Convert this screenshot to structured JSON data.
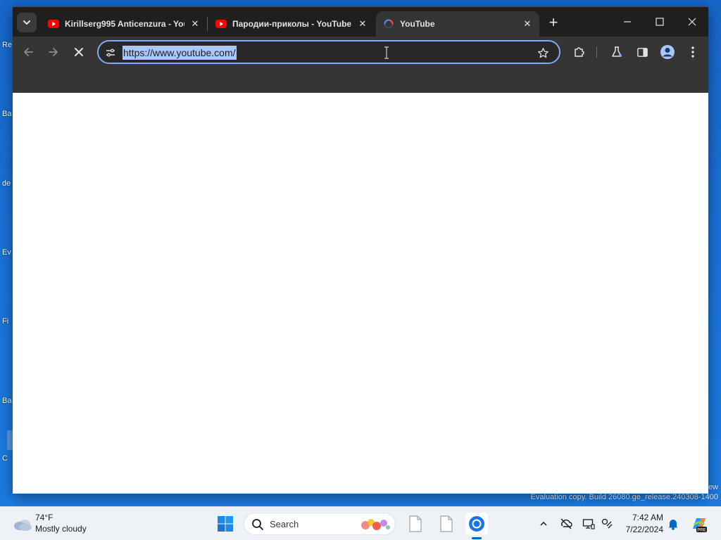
{
  "desktop": {
    "icon_labels": [
      "Re",
      "Ba",
      "de",
      "Ev",
      "Fi",
      "Ba",
      "C"
    ],
    "watermark_line1": "ew",
    "watermark_line2": "Evaluation copy. Build 26080.ge_release.240308-1400"
  },
  "browser": {
    "tabs": [
      {
        "title": "Kirillserg995 Anticenzura - You",
        "favicon": "youtube-icon",
        "active": false
      },
      {
        "title": "Пародии-приколы - YouTube",
        "favicon": "youtube-icon",
        "active": false
      },
      {
        "title": "YouTube",
        "favicon": "loading-spinner-icon",
        "active": true
      }
    ],
    "tab_close_glyph": "✕",
    "new_tab_glyph": "+",
    "window_controls": {
      "minimize": "—",
      "maximize": "☐",
      "close": "✕"
    },
    "toolbar": {
      "back": "back-arrow-icon",
      "forward": "forward-arrow-icon",
      "stop": "stop-loading-icon"
    },
    "omnibox": {
      "url": "https://www.youtube.com/",
      "selected": true
    },
    "toolbar_right": [
      "extensions-icon",
      "labs-icon",
      "side-panel-icon",
      "profile-icon",
      "menu-icon"
    ]
  },
  "taskbar": {
    "weather": {
      "temp": "74°F",
      "condition": "Mostly cloudy"
    },
    "search_label": "Search",
    "clock": {
      "time": "7:42 AM",
      "date": "7/22/2024"
    },
    "tray": [
      "chevron-up-icon",
      "network-off-icon",
      "display-icon",
      "accessibility-icon",
      "notifications-icon"
    ]
  },
  "colors": {
    "accent": "#7cacf8",
    "selection": "#a8c7fa",
    "tabstrip": "#1f1f1f",
    "toolbar": "#353535",
    "youtube_red": "#ff0000",
    "taskbar": "#eef1f6",
    "desktop": "#1a72d8"
  }
}
